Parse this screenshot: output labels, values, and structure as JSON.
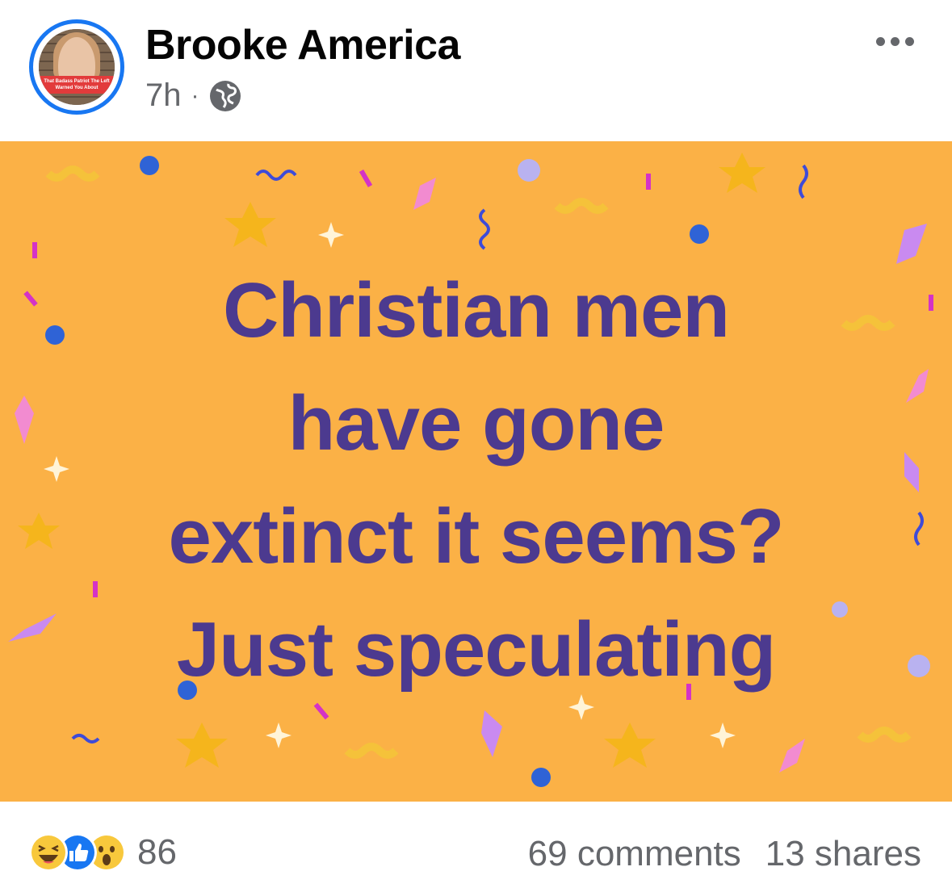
{
  "post": {
    "author": "Brooke America",
    "time": "7h",
    "separator": "·",
    "privacy_icon": "globe-icon",
    "more_icon": "more-options-icon",
    "avatar_banner": "That Badass Patriot The Left Warned You About",
    "text_lines": [
      "Christian men",
      "have gone",
      "extinct it seems?",
      "Just speculating"
    ],
    "background_color": "#fbb146",
    "text_color": "#4c3a8f"
  },
  "footer": {
    "reaction_icons": [
      "haha-icon",
      "like-icon",
      "wow-icon"
    ],
    "reaction_count": "86",
    "comments": "69 comments",
    "shares": "13 shares"
  }
}
